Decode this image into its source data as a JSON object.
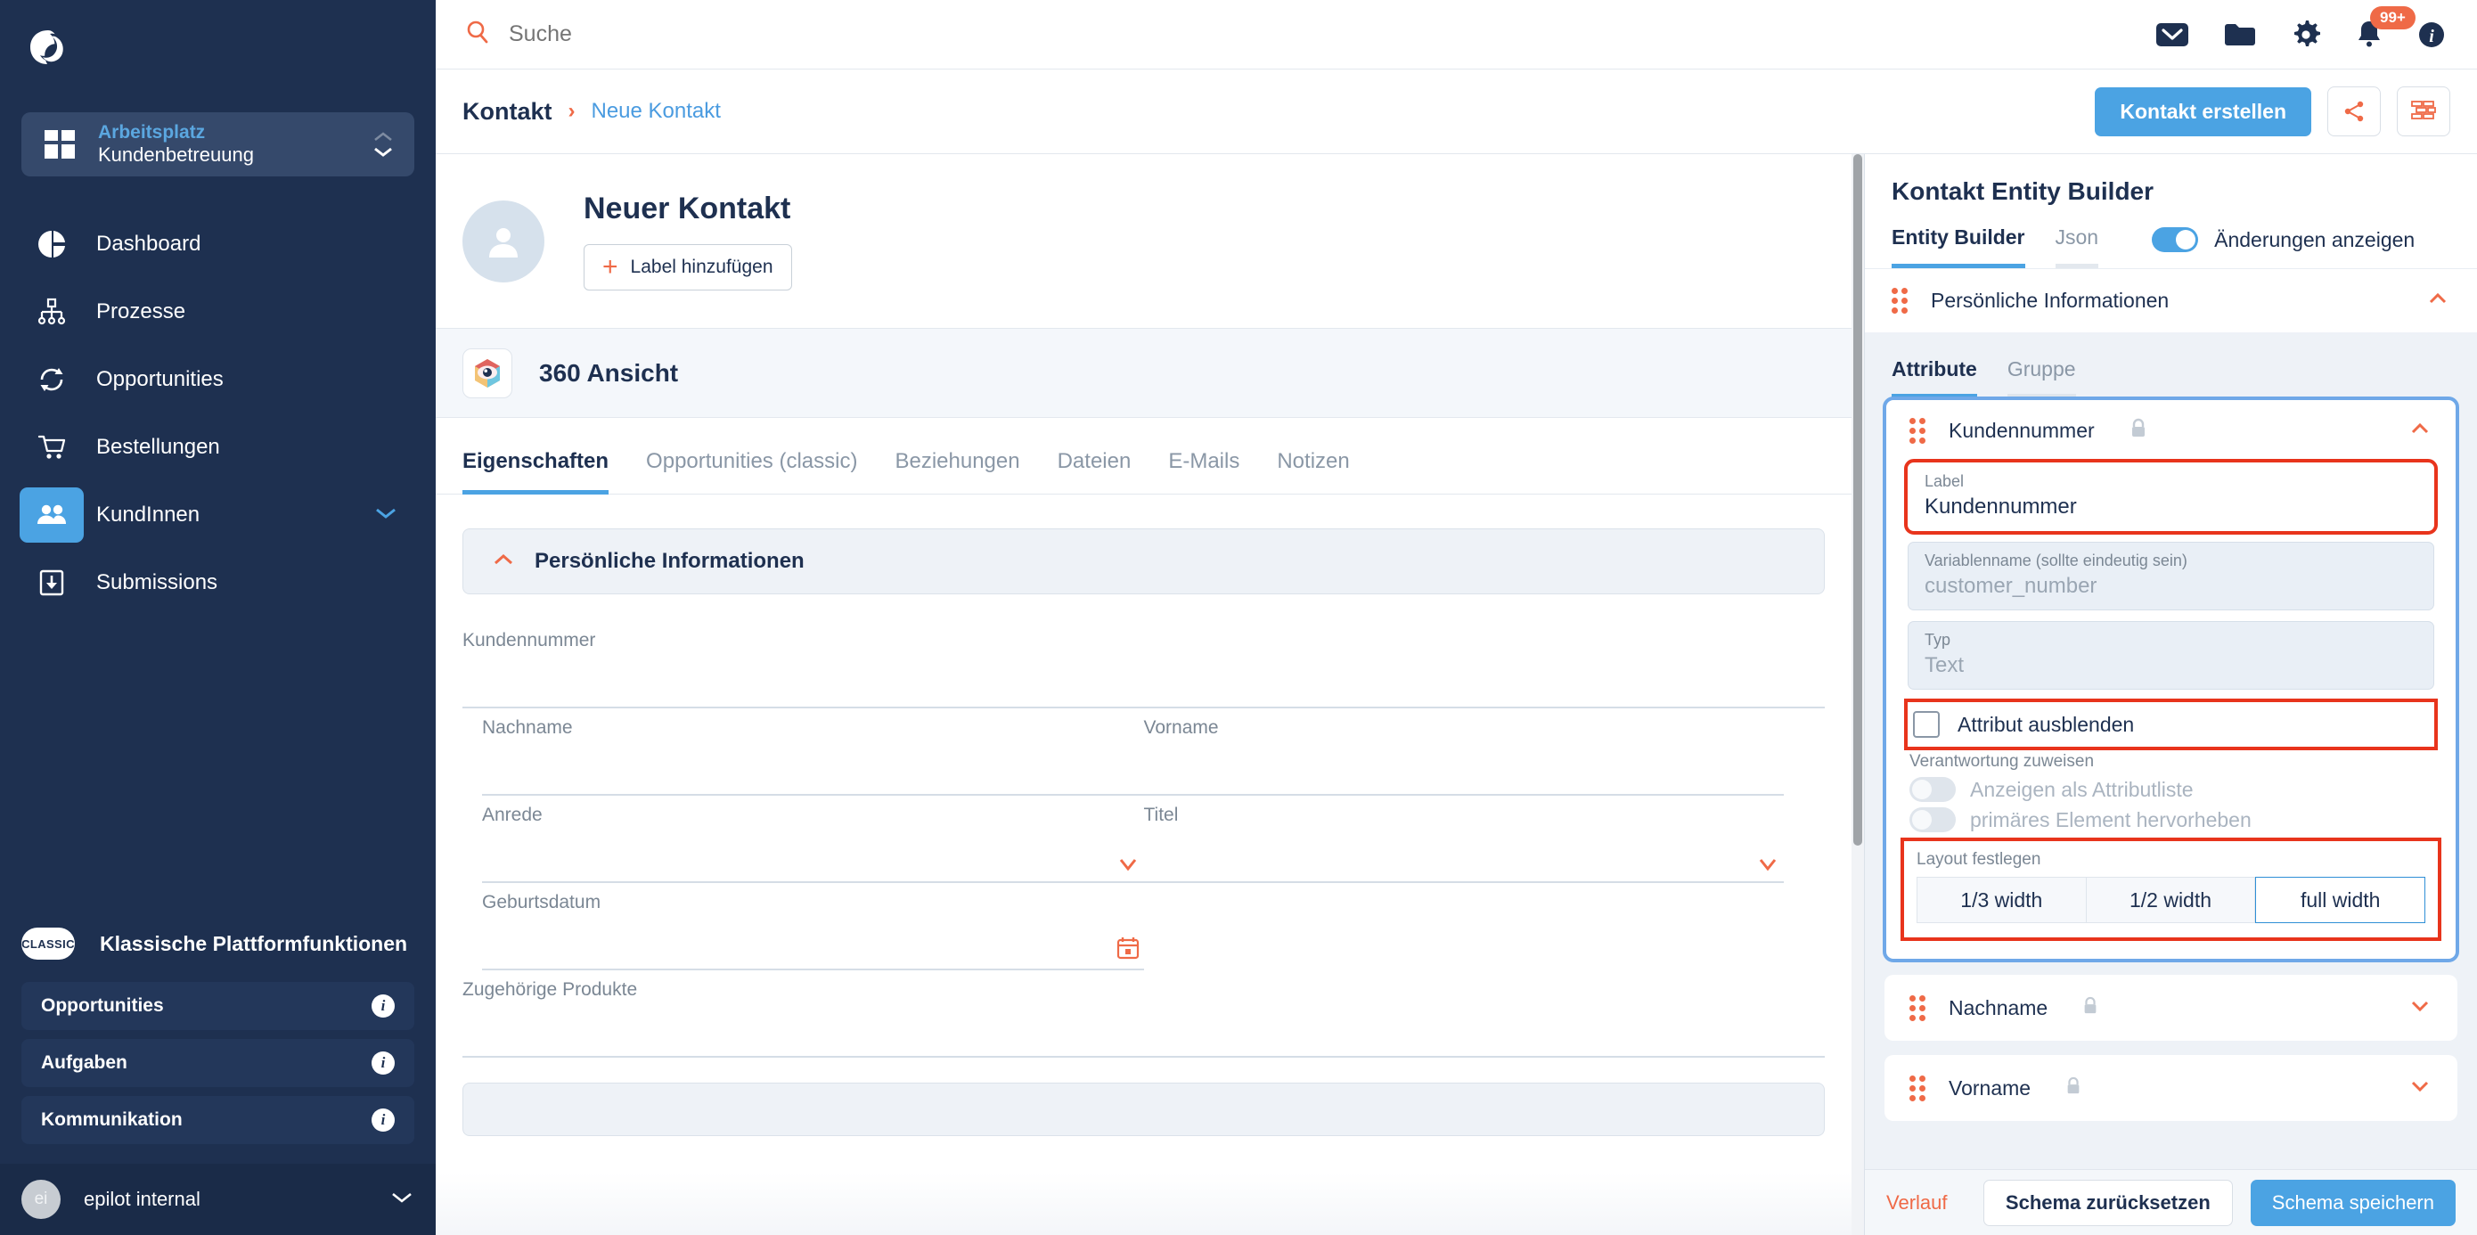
{
  "sidebar": {
    "logo_icon": "epilot-logo-icon",
    "workspace": {
      "kicker": "Arbeitsplatz",
      "name": "Kundenbetreuung",
      "icon": "grid-icon"
    },
    "nav": [
      {
        "label": "Dashboard",
        "icon": "pie-chart-icon",
        "active": false,
        "expandable": false
      },
      {
        "label": "Prozesse",
        "icon": "sitemap-icon",
        "active": false,
        "expandable": false
      },
      {
        "label": "Opportunities",
        "icon": "refresh-cycle-icon",
        "active": false,
        "expandable": false
      },
      {
        "label": "Bestellungen",
        "icon": "shopping-cart-icon",
        "active": false,
        "expandable": false
      },
      {
        "label": "KundInnen",
        "icon": "people-icon",
        "active": true,
        "expandable": true
      },
      {
        "label": "Submissions",
        "icon": "inbox-download-icon",
        "active": false,
        "expandable": false
      }
    ],
    "classic": {
      "pill": "CLASSIC",
      "title": "Klassische Plattformfunktionen",
      "items": [
        {
          "label": "Opportunities",
          "icon": "info-icon"
        },
        {
          "label": "Aufgaben",
          "icon": "info-icon"
        },
        {
          "label": "Kommunikation",
          "icon": "info-icon"
        }
      ]
    },
    "user": {
      "initials": "ei",
      "name": "epilot internal",
      "icon": "chevron-down-icon"
    }
  },
  "topbar": {
    "search": {
      "placeholder": "Suche",
      "value": "",
      "icon": "search-icon"
    },
    "icons": [
      {
        "name": "mail-icon"
      },
      {
        "name": "folder-icon"
      },
      {
        "name": "gear-icon"
      },
      {
        "name": "bell-icon",
        "badge": "99+"
      },
      {
        "name": "info-icon"
      }
    ]
  },
  "breadcrumb": {
    "current": "Kontakt",
    "separator": "›",
    "link": "Neue Kontakt",
    "create_button": "Kontakt erstellen",
    "share_icon": "share-icon",
    "blocks_icon": "bricks-icon"
  },
  "contact": {
    "avatar_icon": "user-avatar-icon",
    "name": "Neuer Kontakt",
    "add_label_button": "Label hinzufügen",
    "plus_icon": "plus-icon"
  },
  "view": {
    "icon": "360-view-icon",
    "title": "360 Ansicht",
    "tabs": [
      {
        "label": "Eigenschaften",
        "active": true
      },
      {
        "label": "Opportunities (classic)",
        "active": false
      },
      {
        "label": "Beziehungen",
        "active": false
      },
      {
        "label": "Dateien",
        "active": false
      },
      {
        "label": "E-Mails",
        "active": false
      },
      {
        "label": "Notizen",
        "active": false
      }
    ]
  },
  "form": {
    "section": {
      "title": "Persönliche Informationen",
      "collapse_icon": "chevron-up-icon",
      "expanded": true
    },
    "fields": [
      {
        "label": "Kundennummer",
        "value": "",
        "width": "full",
        "icon": null
      },
      {
        "label": "Nachname",
        "value": "",
        "width": "half",
        "icon": null
      },
      {
        "label": "Vorname",
        "value": "",
        "width": "half",
        "icon": null
      },
      {
        "label": "Anrede",
        "value": "",
        "width": "half",
        "icon": "chevron-down-icon"
      },
      {
        "label": "Titel",
        "value": "",
        "width": "half",
        "icon": "chevron-down-icon"
      },
      {
        "label": "Geburtsdatum",
        "value": "",
        "width": "half",
        "icon": "calendar-icon"
      },
      {
        "label": "Zugehörige Produkte",
        "value": "",
        "width": "full",
        "icon": null
      }
    ]
  },
  "panel": {
    "title": "Kontakt Entity Builder",
    "tabs": [
      {
        "label": "Entity Builder",
        "active": true
      },
      {
        "label": "Json",
        "active": false
      }
    ],
    "show_changes": {
      "label": "Änderungen anzeigen",
      "on": true
    },
    "group": {
      "name": "Persönliche Informationen",
      "grip_icon": "drag-grip-icon",
      "chevron_icon": "chevron-up-icon",
      "expanded": true
    },
    "sub_tabs": [
      {
        "label": "Attribute",
        "active": true
      },
      {
        "label": "Gruppe",
        "active": false
      }
    ],
    "attribute": {
      "name": "Kundennummer",
      "lock_icon": "lock-icon",
      "grip_icon": "drag-grip-icon",
      "chevron_icon": "chevron-up-icon",
      "label_field": {
        "label": "Label",
        "value": "Kundennummer"
      },
      "varname_field": {
        "label": "Variablenname (sollte eindeutig sein)",
        "value": "customer_number"
      },
      "type_field": {
        "label": "Typ",
        "value": "Text"
      },
      "hide_attribute": {
        "label": "Attribut ausblenden",
        "checked": false
      },
      "responsibility_label": "Verantwortung zuweisen",
      "toggles": [
        {
          "label": "Anzeigen als Attributliste",
          "on": false
        },
        {
          "label": "primäres Element hervorheben",
          "on": false
        }
      ],
      "layout": {
        "label": "Layout festlegen",
        "options": [
          {
            "label": "1/3 width",
            "selected": false
          },
          {
            "label": "1/2 width",
            "selected": false
          },
          {
            "label": "full width",
            "selected": true
          }
        ]
      }
    },
    "other_attributes": [
      {
        "name": "Nachname",
        "lock_icon": "lock-icon",
        "grip_icon": "drag-grip-icon",
        "chevron_icon": "chevron-down-icon"
      },
      {
        "name": "Vorname",
        "lock_icon": "lock-icon",
        "grip_icon": "drag-grip-icon",
        "chevron_icon": "chevron-down-icon"
      }
    ],
    "footer": {
      "history": "Verlauf",
      "reset": "Schema zurücksetzen",
      "save": "Schema speichern"
    }
  },
  "colors": {
    "accent_blue": "#4ba3e3",
    "accent_orange": "#ef6a47",
    "sidebar_bg": "#1e3050",
    "highlight_red": "#e8341c",
    "highlight_blue": "#6fa8e8"
  }
}
